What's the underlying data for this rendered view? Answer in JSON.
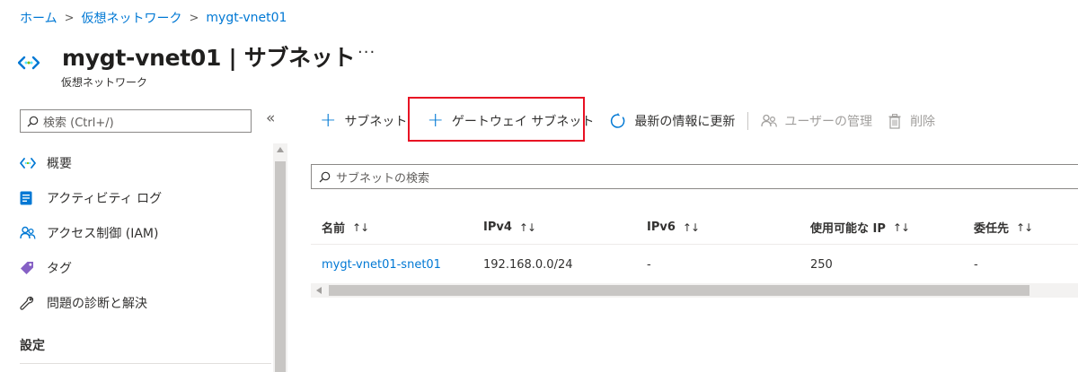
{
  "breadcrumb": {
    "items": [
      "ホーム",
      "仮想ネットワーク",
      "mygt-vnet01"
    ],
    "separator": ">"
  },
  "header": {
    "resource_name": "mygt-vnet01",
    "title_sep": " | ",
    "section": "サブネット",
    "more": "···",
    "subtitle": "仮想ネットワーク",
    "icon": "vnet-icon"
  },
  "sidebar": {
    "search_placeholder": "検索 (Ctrl+/)",
    "collapse": "«",
    "items": [
      {
        "label": "概要",
        "icon": "vnet-overview-icon"
      },
      {
        "label": "アクティビティ ログ",
        "icon": "activity-log-icon"
      },
      {
        "label": "アクセス制御 (IAM)",
        "icon": "iam-people-icon"
      },
      {
        "label": "タグ",
        "icon": "tag-icon"
      },
      {
        "label": "問題の診断と解決",
        "icon": "wrench-icon"
      }
    ],
    "section_label": "設定"
  },
  "toolbar": {
    "add_subnet": "サブネット",
    "add_gateway_subnet": "ゲートウェイ サブネット",
    "refresh": "最新の情報に更新",
    "manage_users": "ユーザーの管理",
    "delete": "削除"
  },
  "main": {
    "search_placeholder": "サブネットの検索",
    "columns": [
      "名前",
      "IPv4",
      "IPv6",
      "使用可能な IP",
      "委任先"
    ],
    "sort_glyph": "↑↓",
    "rows": [
      {
        "name": "mygt-vnet01-snet01",
        "ipv4": "192.168.0.0/24",
        "ipv6": "-",
        "available_ip": "250",
        "delegated_to": "-"
      }
    ]
  },
  "colors": {
    "link": "#0078d4",
    "highlight": "#e81123",
    "text": "#323130"
  }
}
